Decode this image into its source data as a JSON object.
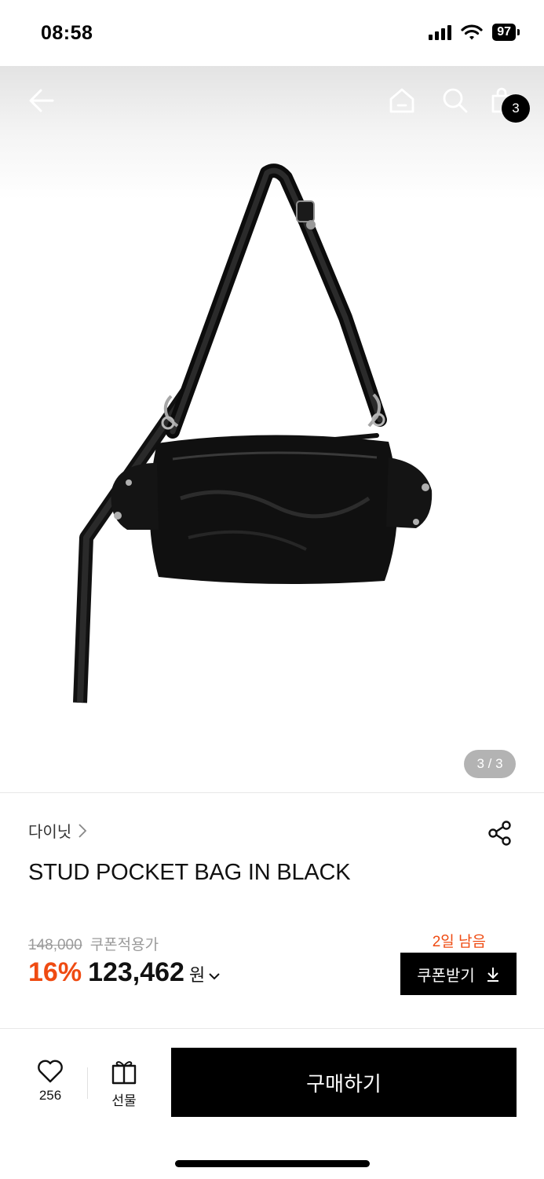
{
  "status_bar": {
    "time": "08:58",
    "battery": "97"
  },
  "nav": {
    "back_icon": "arrow-left-icon",
    "home_icon": "home-icon",
    "search_icon": "search-icon",
    "cart_icon": "shopping-bag-icon",
    "cart_count": "3"
  },
  "gallery": {
    "indicator": "3 / 3",
    "product_image": "black leather shoulder bag"
  },
  "product": {
    "brand": "다이닛",
    "name": "STUD POCKET BAG IN BLACK",
    "share_icon": "share-icon"
  },
  "price": {
    "original": "148,000",
    "coupon_label": "쿠폰적용가",
    "discount": "16%",
    "sale": "123,462",
    "currency": "원",
    "days_left": "2일 남음",
    "coupon_button": "쿠폰받기",
    "accent_color": "#ef4b12"
  },
  "actions": {
    "like_count": "256",
    "gift_label": "선물",
    "buy_label": "구매하기"
  }
}
